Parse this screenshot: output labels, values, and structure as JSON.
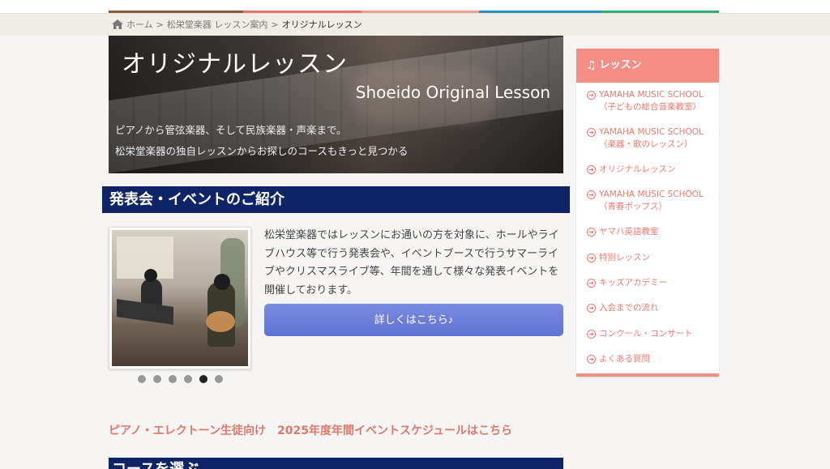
{
  "nav": {
    "tab_colors": [
      "#8b5a3c",
      "#e57373",
      "#f0a090",
      "#2b8fc2",
      "#2fae70"
    ]
  },
  "breadcrumb": {
    "home": "ホーム",
    "parent": "松栄堂楽器 レッスン案内",
    "current": "オリジナルレッスン",
    "separator": ">"
  },
  "hero": {
    "title": "オリジナルレッスン",
    "subtitle": "Shoeido Original Lesson",
    "line1": "ピアノから管弦楽器、そして民族楽器・声楽まで。",
    "line2": "松栄堂楽器の独自レッスンからお探しのコースもきっと見つかる"
  },
  "events": {
    "heading": "発表会・イベントのご紹介",
    "description": "松栄堂楽器ではレッスンにお通いの方を対象に、ホールやライブハウス等で行う発表会や、イベントブースで行うサマーライブやクリスマスライブ等、年間を通して様々な発表イベントを開催しております。",
    "button": "詳しくはこちら♪",
    "slides_total": 6,
    "slide_active": 5
  },
  "schedule_link": "ピアノ・エレクトーン生徒向け　2025年度年間イベントスケジュールはこちら",
  "course_heading": "コースを選ぶ",
  "sidebar": {
    "title": "レッスン",
    "items": [
      {
        "line1": "YAMAHA MUSIC SCHOOL",
        "line2": "（子どもの総合音楽教室）"
      },
      {
        "line1": "YAMAHA MUSIC SCHOOL",
        "line2": "（楽器・歌のレッスン）"
      },
      {
        "line1": "オリジナルレッスン",
        "line2": ""
      },
      {
        "line1": "YAMAHA MUSIC SCHOOL",
        "line2": "（青春ポップス）"
      },
      {
        "line1": "ヤマハ英語教室",
        "line2": ""
      },
      {
        "line1": "特別レッスン",
        "line2": ""
      },
      {
        "line1": "キッズアカデミー",
        "line2": ""
      },
      {
        "line1": "入会までの流れ",
        "line2": ""
      },
      {
        "line1": "コンクール・コンサート",
        "line2": ""
      },
      {
        "line1": "よくある質問",
        "line2": ""
      }
    ]
  },
  "colors": {
    "navy": "#0f2467",
    "salmon": "#f58f85",
    "button": "#6b7edb",
    "link": "#e0786c"
  }
}
